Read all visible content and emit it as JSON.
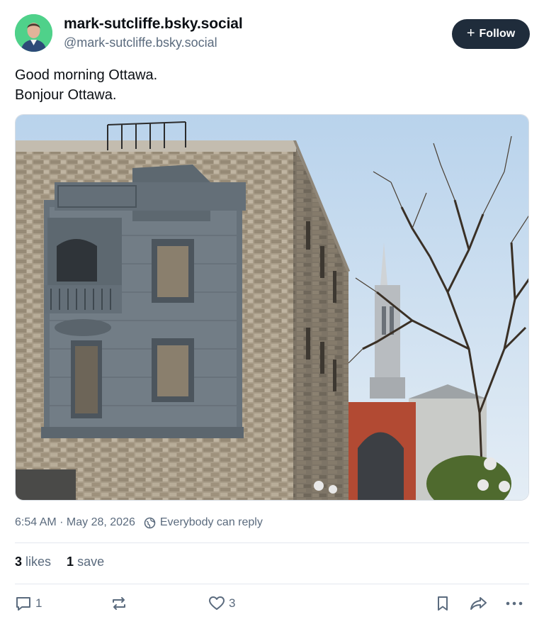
{
  "author": {
    "display_name": "mark-sutcliffe.bsky.social",
    "handle": "@mark-sutcliffe.bsky.social",
    "avatar_icon": "avatar-photo"
  },
  "follow_button": {
    "label": "Follow",
    "icon": "plus-icon"
  },
  "post": {
    "lines": [
      "Good morning Ottawa.",
      "Bonjour Ottawa."
    ],
    "image_icon": "photo-stone-building-church-spire"
  },
  "meta": {
    "timestamp": "6:54 AM · May 28, 2026",
    "reply_setting": "Everybody can reply",
    "reply_icon": "globe-icon"
  },
  "stats": {
    "likes_count": "3",
    "likes_label": "likes",
    "saves_count": "1",
    "saves_label": "save"
  },
  "actions": {
    "reply_count": "1",
    "repost_count": "",
    "like_count": "3"
  },
  "colors": {
    "follow_bg": "#1f2c3b",
    "muted_text": "#5b6b7e",
    "avatar_bg": "#4fd18a"
  }
}
